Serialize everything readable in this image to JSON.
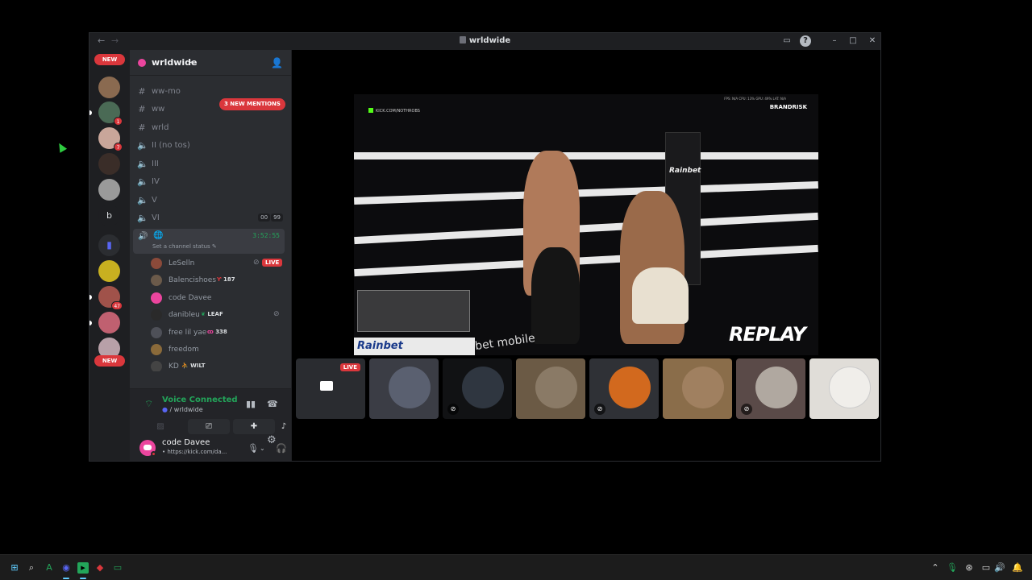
{
  "window": {
    "title": "wrldwide"
  },
  "servers": {
    "new_top": "NEW",
    "new_bottom": "NEW",
    "badges": [
      "1",
      "7",
      "47"
    ],
    "folder_letter": "b"
  },
  "guild": {
    "name": "wrldwide"
  },
  "mentions_label": "3 NEW MENTIONS",
  "channels": [
    {
      "name": "ww-mo",
      "type": "text"
    },
    {
      "name": "ww",
      "type": "text"
    },
    {
      "name": "wrld",
      "type": "text"
    },
    {
      "name": "II (no tos)",
      "type": "voice"
    },
    {
      "name": "III",
      "type": "voice"
    },
    {
      "name": "IV",
      "type": "voice"
    },
    {
      "name": "V",
      "type": "voice"
    },
    {
      "name": "VI",
      "type": "voice"
    }
  ],
  "vi_counter": [
    "00",
    "99"
  ],
  "active_voice": {
    "timer": "3:52:55",
    "status": "Set a channel status"
  },
  "voice_users": [
    {
      "name": "LeSelln",
      "tag": "",
      "live": "LIVE",
      "avatar_color": "#8b4a3a"
    },
    {
      "name": "Balencishoes",
      "tag": "187",
      "live": "",
      "avatar_color": "#6b5a4a"
    },
    {
      "name": "code Davee",
      "tag": "",
      "live": "",
      "avatar_color": "#eb459e"
    },
    {
      "name": "danibleu",
      "tag": "LEAF",
      "live": "",
      "avatar_color": "#2a2a2a"
    },
    {
      "name": "free lil yae",
      "tag": "338",
      "live": "",
      "avatar_color": "#4e5058"
    },
    {
      "name": "freedom",
      "tag": "",
      "live": "",
      "avatar_color": "#8a6a3a"
    },
    {
      "name": "KD",
      "tag": "WILT",
      "live": "",
      "avatar_color": "#444"
    }
  ],
  "voice_panel": {
    "title": "Voice Connected",
    "subtitle": "/ wrldwide"
  },
  "user": {
    "name": "code Davee",
    "status": "• https://kick.com/da..."
  },
  "video": {
    "url": "KICK.COM/NOTHROBS",
    "logo": "BRANDRISK",
    "stats": "FPS: N/A   CPU: 13%   GPU: 49%   LAT: N/A",
    "replay": "REPLAY",
    "sponsor": "Rainbet",
    "ring_brand": "Rainbet",
    "mobile": "bet mobile"
  },
  "tiles": [
    {
      "kind": "stream",
      "live": "LIVE",
      "color": "#2a2c30"
    },
    {
      "kind": "avatar",
      "color": "#3b3d45",
      "avatar": "#5a6070",
      "muted": false
    },
    {
      "kind": "avatar",
      "color": "#111214",
      "avatar": "#2f3640",
      "muted": true
    },
    {
      "kind": "avatar",
      "color": "#6b5a45",
      "avatar": "#8a7a66",
      "muted": false
    },
    {
      "kind": "avatar",
      "color": "#2f3136",
      "avatar": "#d2691e",
      "muted": true
    },
    {
      "kind": "avatar",
      "color": "#8a6d4a",
      "avatar": "#a08060",
      "muted": false
    },
    {
      "kind": "avatar",
      "color": "#5a4a48",
      "avatar": "#b0a8a0",
      "muted": true
    },
    {
      "kind": "avatar",
      "color": "#e0ddd8",
      "avatar": "#f0eeea",
      "muted": false
    }
  ],
  "colors": {
    "accent": "#5865f2",
    "danger": "#da373c",
    "online": "#23a55a"
  }
}
